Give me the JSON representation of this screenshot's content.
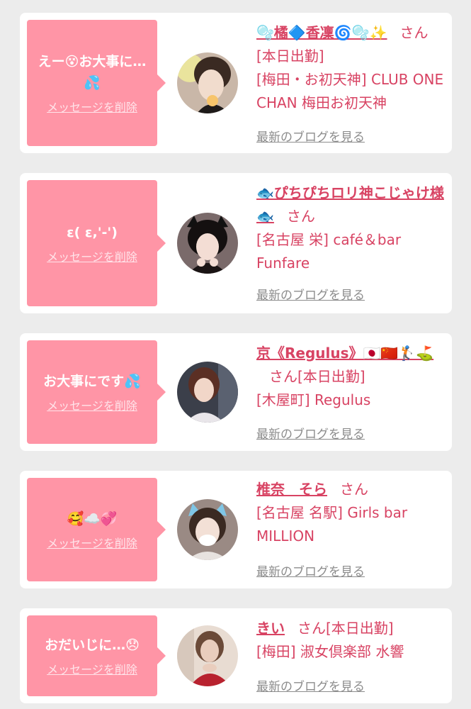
{
  "messages": [
    {
      "bubble_text": "えー😵お大事に…💦",
      "delete_label": "メッセージを削除",
      "cast_name": "🫧橘🔷香凜🌀🫧✨",
      "suffix": "さん",
      "status": "[本日出勤]",
      "shop": "[梅田・お初天神] CLUB ONE CHAN 梅田お初天神",
      "blog_label": "最新のブログを見る"
    },
    {
      "bubble_text": "ε( ε,'-')",
      "delete_label": "メッセージを削除",
      "cast_name": "🐟ぴちぴちロリ神こじゃけ様🐟",
      "suffix": "さん",
      "status": "",
      "shop": "[名古屋 栄] café＆bar Funfare",
      "blog_label": "最新のブログを見る"
    },
    {
      "bubble_text": "お大事にです💦",
      "delete_label": "メッセージを削除",
      "cast_name": "京《Regulus》🇯🇵🇨🇳🏌️⛳️",
      "suffix": "さん",
      "status": "[本日出勤]",
      "shop": "[木屋町] Regulus",
      "blog_label": "最新のブログを見る"
    },
    {
      "bubble_text": "🥰☁️💞",
      "delete_label": "メッセージを削除",
      "cast_name": "椎奈　そら",
      "suffix": "さん",
      "status": "",
      "shop": "[名古屋 名駅] Girls bar MILLION",
      "blog_label": "最新のブログを見る"
    },
    {
      "bubble_text": "おだいじに…😞",
      "delete_label": "メッセージを削除",
      "cast_name": "きい",
      "suffix": "さん",
      "status": "[本日出勤]",
      "shop": "[梅田] 淑女倶楽部 水響",
      "blog_label": "最新のブログを見る"
    }
  ],
  "colors": {
    "bubble": "#ff95a6",
    "accent_text": "#d84363",
    "link_gray": "#8c8c8c",
    "background": "#ececec"
  }
}
